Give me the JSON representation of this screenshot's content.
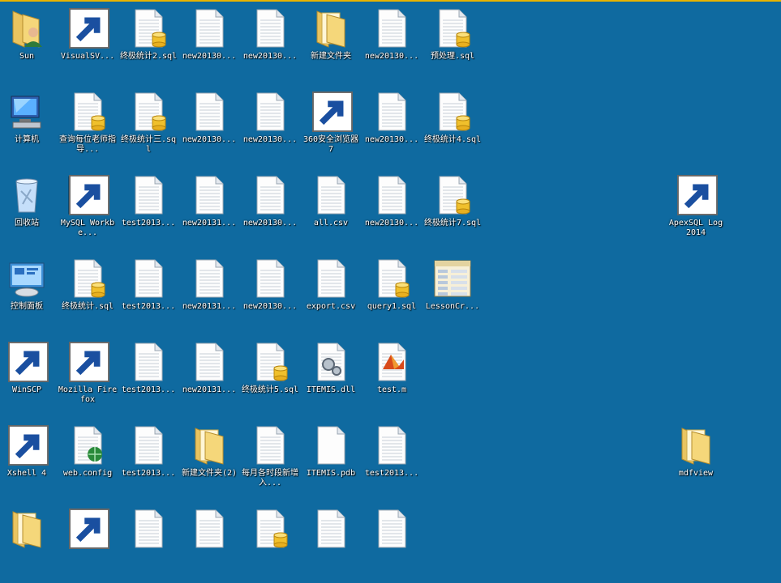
{
  "desktop": {
    "icons": [
      {
        "id": "sun",
        "label": "Sun",
        "type": "user-folder",
        "col": 0,
        "row": 0
      },
      {
        "id": "visualsvn",
        "label": "VisualSV...",
        "type": "installer",
        "col": 1,
        "row": 0
      },
      {
        "id": "f1",
        "label": "终极统计2.sql",
        "type": "sql",
        "col": 2,
        "row": 0
      },
      {
        "id": "f2",
        "label": "new20130...",
        "type": "text",
        "col": 3,
        "row": 0
      },
      {
        "id": "f3",
        "label": "new20130...",
        "type": "text",
        "col": 4,
        "row": 0
      },
      {
        "id": "f4",
        "label": "新建文件夹",
        "type": "folder",
        "col": 5,
        "row": 0
      },
      {
        "id": "f5",
        "label": "new20130...",
        "type": "text",
        "col": 6,
        "row": 0
      },
      {
        "id": "f6",
        "label": "预处理.sql",
        "type": "sql",
        "col": 7,
        "row": 0
      },
      {
        "id": "computer",
        "label": "计算机",
        "type": "computer",
        "col": 0,
        "row": 1
      },
      {
        "id": "f7",
        "label": "查询每位老师指导...",
        "type": "sql",
        "col": 1,
        "row": 1
      },
      {
        "id": "f8",
        "label": "终极统计三.sql",
        "type": "sql",
        "col": 2,
        "row": 1
      },
      {
        "id": "f9",
        "label": "new20130...",
        "type": "text",
        "col": 3,
        "row": 1
      },
      {
        "id": "f10",
        "label": "new20130...",
        "type": "text",
        "col": 4,
        "row": 1
      },
      {
        "id": "browser360",
        "label": "360安全浏览器7",
        "type": "browser360",
        "col": 5,
        "row": 1
      },
      {
        "id": "f11",
        "label": "new20130...",
        "type": "text",
        "col": 6,
        "row": 1
      },
      {
        "id": "f12",
        "label": "终极统计4.sql",
        "type": "sql",
        "col": 7,
        "row": 1
      },
      {
        "id": "recycle",
        "label": "回收站",
        "type": "recycle",
        "col": 0,
        "row": 2
      },
      {
        "id": "mysql",
        "label": "MySQL Workbe...",
        "type": "mysql",
        "col": 1,
        "row": 2
      },
      {
        "id": "f13",
        "label": "test2013...",
        "type": "text",
        "col": 2,
        "row": 2
      },
      {
        "id": "f14",
        "label": "new20131...",
        "type": "text",
        "col": 3,
        "row": 2
      },
      {
        "id": "f15",
        "label": "new20130...",
        "type": "text",
        "col": 4,
        "row": 2
      },
      {
        "id": "f16",
        "label": "all.csv",
        "type": "text",
        "col": 5,
        "row": 2
      },
      {
        "id": "f17",
        "label": "new20130...",
        "type": "text",
        "col": 6,
        "row": 2
      },
      {
        "id": "f18",
        "label": "终极统计7.sql",
        "type": "sql",
        "col": 7,
        "row": 2
      },
      {
        "id": "apexsql",
        "label": "ApexSQL Log 2014",
        "type": "apexsql",
        "col": 11,
        "row": 2
      },
      {
        "id": "control",
        "label": "控制面板",
        "type": "control",
        "col": 0,
        "row": 3
      },
      {
        "id": "f19",
        "label": "终极统计.sql",
        "type": "sql",
        "col": 1,
        "row": 3
      },
      {
        "id": "f20",
        "label": "test2013...",
        "type": "text",
        "col": 2,
        "row": 3
      },
      {
        "id": "f21",
        "label": "new20131...",
        "type": "text",
        "col": 3,
        "row": 3
      },
      {
        "id": "f22",
        "label": "new20130...",
        "type": "text",
        "col": 4,
        "row": 3
      },
      {
        "id": "f23",
        "label": "export.csv",
        "type": "text",
        "col": 5,
        "row": 3
      },
      {
        "id": "f24",
        "label": "query1.sql",
        "type": "sql",
        "col": 6,
        "row": 3
      },
      {
        "id": "f25",
        "label": "LessonCr...",
        "type": "lesson",
        "col": 7,
        "row": 3
      },
      {
        "id": "winscp",
        "label": "WinSCP",
        "type": "winscp",
        "col": 0,
        "row": 4
      },
      {
        "id": "firefox",
        "label": "Mozilla Firefox",
        "type": "firefox",
        "col": 1,
        "row": 4
      },
      {
        "id": "f26",
        "label": "test2013...",
        "type": "text",
        "col": 2,
        "row": 4
      },
      {
        "id": "f27",
        "label": "new20131...",
        "type": "text",
        "col": 3,
        "row": 4
      },
      {
        "id": "f28",
        "label": "终极统计5.sql",
        "type": "sql",
        "col": 4,
        "row": 4
      },
      {
        "id": "f29",
        "label": "ITEMIS.dll",
        "type": "dll",
        "col": 5,
        "row": 4
      },
      {
        "id": "f30",
        "label": "test.m",
        "type": "matlab",
        "col": 6,
        "row": 4
      },
      {
        "id": "xshell",
        "label": "Xshell 4",
        "type": "xshell",
        "col": 0,
        "row": 5
      },
      {
        "id": "f31",
        "label": "web.config",
        "type": "webconfig",
        "col": 1,
        "row": 5
      },
      {
        "id": "f32",
        "label": "test2013...",
        "type": "text",
        "col": 2,
        "row": 5
      },
      {
        "id": "f33",
        "label": "新建文件夹(2)",
        "type": "folder",
        "col": 3,
        "row": 5
      },
      {
        "id": "f34",
        "label": "每月各时段新增入...",
        "type": "text",
        "col": 4,
        "row": 5
      },
      {
        "id": "f35",
        "label": "ITEMIS.pdb",
        "type": "blank",
        "col": 5,
        "row": 5
      },
      {
        "id": "f36",
        "label": "test2013...",
        "type": "text",
        "col": 6,
        "row": 5
      },
      {
        "id": "mdfview",
        "label": "mdfview",
        "type": "folder",
        "col": 11,
        "row": 5
      },
      {
        "id": "p1",
        "label": "",
        "type": "folder",
        "col": 0,
        "row": 6
      },
      {
        "id": "p2",
        "label": "",
        "type": "globe",
        "col": 1,
        "row": 6
      },
      {
        "id": "p3",
        "label": "",
        "type": "text",
        "col": 2,
        "row": 6
      },
      {
        "id": "p4",
        "label": "",
        "type": "text",
        "col": 3,
        "row": 6
      },
      {
        "id": "p5",
        "label": "",
        "type": "sql",
        "col": 4,
        "row": 6
      },
      {
        "id": "p6",
        "label": "",
        "type": "text",
        "col": 5,
        "row": 6
      },
      {
        "id": "p7",
        "label": "",
        "type": "text",
        "col": 6,
        "row": 6
      }
    ]
  },
  "colors": {
    "desktop_background": "#0f6aa0",
    "top_highlight": "#e8b400"
  }
}
